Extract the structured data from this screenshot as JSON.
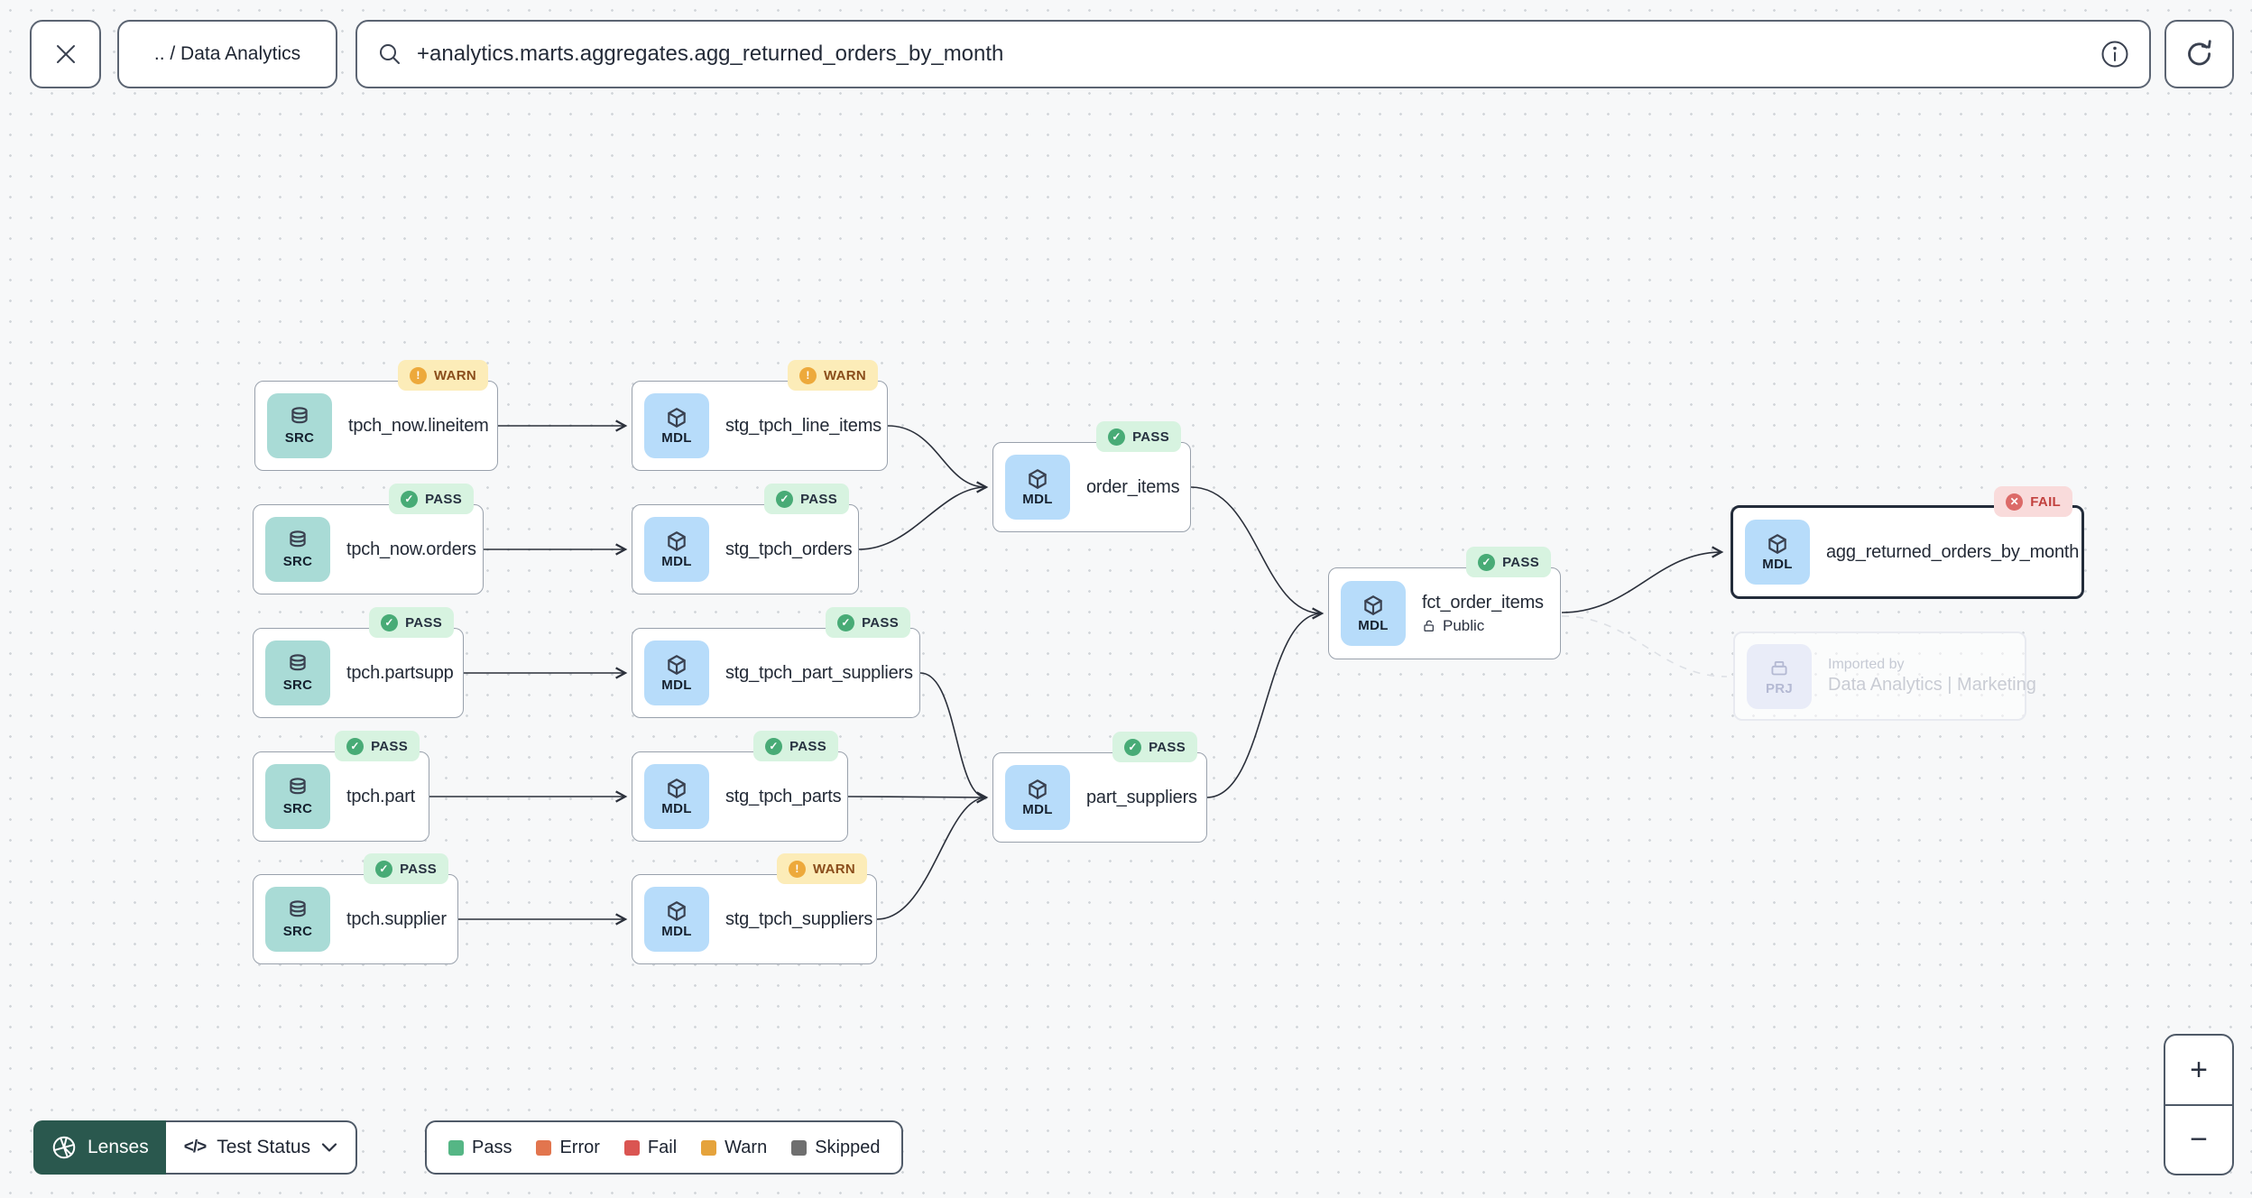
{
  "toolbar": {
    "breadcrumb": ".. / Data Analytics",
    "search_value": "+analytics.marts.aggregates.agg_returned_orders_by_month"
  },
  "nodes": [
    {
      "label": "tpch_now.lineitem",
      "type": "SRC",
      "status": "WARN"
    },
    {
      "label": "tpch_now.orders",
      "type": "SRC",
      "status": "PASS"
    },
    {
      "label": "tpch.partsupp",
      "type": "SRC",
      "status": "PASS"
    },
    {
      "label": "tpch.part",
      "type": "SRC",
      "status": "PASS"
    },
    {
      "label": "tpch.supplier",
      "type": "SRC",
      "status": "PASS"
    },
    {
      "label": "stg_tpch_line_items",
      "type": "MDL",
      "status": "WARN"
    },
    {
      "label": "stg_tpch_orders",
      "type": "MDL",
      "status": "PASS"
    },
    {
      "label": "stg_tpch_part_suppliers",
      "type": "MDL",
      "status": "PASS"
    },
    {
      "label": "stg_tpch_parts",
      "type": "MDL",
      "status": "PASS"
    },
    {
      "label": "stg_tpch_suppliers",
      "type": "MDL",
      "status": "WARN"
    },
    {
      "label": "order_items",
      "type": "MDL",
      "status": "PASS"
    },
    {
      "label": "part_suppliers",
      "type": "MDL",
      "status": "PASS"
    },
    {
      "label": "fct_order_items",
      "type": "MDL",
      "status": "PASS",
      "visibility": "Public"
    },
    {
      "label": "agg_returned_orders_by_month",
      "type": "MDL",
      "status": "FAIL",
      "selected": true
    }
  ],
  "ghost_node": {
    "type": "PRJ",
    "line1": "Imported by",
    "line2": "Data Analytics | Marketing"
  },
  "badge_icons": {
    "pass": "✓",
    "warn": "!",
    "fail": "✕"
  },
  "footer": {
    "lenses_label": "Lenses",
    "lens_selector_label": "Test Status",
    "code_glyph": "</>",
    "legend": [
      {
        "label": "Pass",
        "color": "#55b685"
      },
      {
        "label": "Error",
        "color": "#e2754e"
      },
      {
        "label": "Fail",
        "color": "#da5552"
      },
      {
        "label": "Warn",
        "color": "#e5a33c"
      },
      {
        "label": "Skipped",
        "color": "#6f6f6f"
      }
    ]
  },
  "zoom_controls": {
    "zoom_in": "+",
    "zoom_out": "−"
  },
  "colors": {
    "canvas_bg": "#f7f8f9",
    "node_border": "#99a1ac",
    "selected_node_border": "#232c3a",
    "edge": "#2b303b",
    "ghost_edge": "#dde0e5",
    "src_chip_bg": "#a9dbd6",
    "mdl_chip_bg": "#b7dcfa",
    "pass_badge_bg": "#d7f3e0",
    "warn_badge_bg": "#fcecb8",
    "fail_badge_bg": "#f9dbdb",
    "lenses_button_bg": "#2a584e"
  }
}
